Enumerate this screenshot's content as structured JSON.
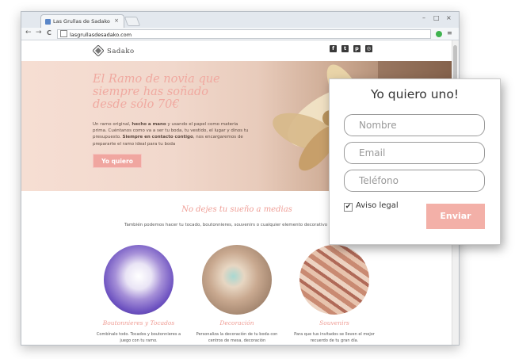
{
  "browser": {
    "tab_title": "Las Grullas de Sadako",
    "tab_close": "×",
    "url": "lasgrullasdesadako.com",
    "nav": {
      "back": "←",
      "forward": "→",
      "reload": "C"
    },
    "menu": "≡",
    "window_controls": {
      "minimize": "–",
      "maximize": "□",
      "close": "×"
    }
  },
  "site": {
    "logo_text": "Sadako",
    "social": [
      {
        "icon": "facebook-icon",
        "glyph": "f"
      },
      {
        "icon": "twitter-icon",
        "glyph": "t"
      },
      {
        "icon": "pinterest-icon",
        "glyph": "p"
      },
      {
        "icon": "instagram-icon",
        "glyph": "◎"
      }
    ]
  },
  "hero": {
    "heading": "El Ramo de novia que siempre has soñado desde sólo 70€",
    "text_before_1": "Un ramo original, ",
    "text_bold_1": "hecho a mano",
    "text_mid_1": " y usando el papel como materia prima. Cuéntanos como va a ser tu boda, tu vestido, el lugar y dinos tu presupuesto. ",
    "text_bold_2": "Siempre en contacto contigo",
    "text_after": ", nos encargaremos de prepararte el ramo ideal para tu boda",
    "cta": "Yo quiero"
  },
  "section": {
    "title": "No dejes tu sueño a medias",
    "subtitle": "También podemos hacer tu tocado, boutonnieres, souvenirs o cualquier elemento decorativo para la boda de"
  },
  "cards": [
    {
      "title": "Boutonnieres y Tocados",
      "text": "Combínalo todo. Tocados y boutonnieres a juego con tu ramo."
    },
    {
      "title": "Decoración",
      "text": "Personaliza la decoración de tu boda con centros de mesa, decoración"
    },
    {
      "title": "Souvenirs",
      "text": "Para que tus invitados se lleven el mejor recuerdo de tu gran día."
    }
  ],
  "popup": {
    "title": "Yo quiero uno!",
    "fields": {
      "name": "Nombre",
      "email": "Email",
      "phone": "Teléfono"
    },
    "checkbox_label": "Aviso legal",
    "checkbox_checked": true,
    "check_glyph": "✔",
    "submit": "Enviar"
  },
  "colors": {
    "accent": "#f0a6a0",
    "button": "#f3b0a8",
    "heading_pink": "#ef9e96"
  }
}
